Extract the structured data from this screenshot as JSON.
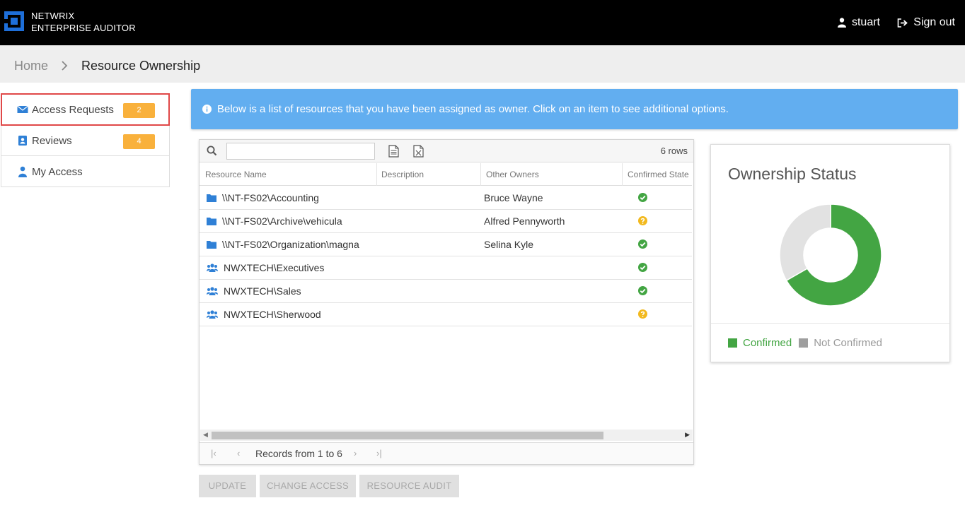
{
  "header": {
    "brand_line1": "NETWRIX",
    "brand_line2": "ENTERPRISE AUDITOR",
    "user_label": "stuart",
    "signout_label": "Sign out"
  },
  "breadcrumb": {
    "home": "Home",
    "separator": ">",
    "current": "Resource Ownership"
  },
  "sidebar": {
    "items": [
      {
        "label": "Access Requests",
        "badge": "2",
        "icon": "envelope-icon"
      },
      {
        "label": "Reviews",
        "badge": "4",
        "icon": "reviews-icon"
      },
      {
        "label": "My Access",
        "icon": "user-icon"
      }
    ]
  },
  "banner": {
    "text": "Below is a list of resources that you have been assigned as owner. Click on an item to see additional options."
  },
  "grid": {
    "search_value": "",
    "row_count": "6 rows",
    "columns": [
      "Resource Name",
      "Description",
      "Other Owners",
      "Confirmed State"
    ],
    "rows": [
      {
        "name": "\\\\NT-FS02\\Accounting",
        "description": "",
        "owner": "Bruce Wayne",
        "type": "folder",
        "state": "confirmed"
      },
      {
        "name": "\\\\NT-FS02\\Archive\\vehicula",
        "description": "",
        "owner": "Alfred Pennyworth",
        "type": "folder",
        "state": "unconfirmed"
      },
      {
        "name": "\\\\NT-FS02\\Organization\\magna",
        "description": "",
        "owner": "Selina Kyle",
        "type": "folder",
        "state": "confirmed"
      },
      {
        "name": "NWXTECH\\Executives",
        "description": "",
        "owner": "",
        "type": "group",
        "state": "confirmed"
      },
      {
        "name": "NWXTECH\\Sales",
        "description": "",
        "owner": "",
        "type": "group",
        "state": "confirmed"
      },
      {
        "name": "NWXTECH\\Sherwood",
        "description": "",
        "owner": "",
        "type": "group",
        "state": "unconfirmed"
      }
    ],
    "pager_text": "Records from 1 to 6"
  },
  "actions": {
    "update": "UPDATE",
    "change_access": "CHANGE ACCESS",
    "resource_audit": "RESOURCE AUDIT"
  },
  "ownership": {
    "title": "Ownership Status",
    "confirmed_label": "Confirmed",
    "not_confirmed_label": "Not Confirmed",
    "confirmed_count": 4,
    "not_confirmed_count": 2,
    "confirmed_color": "#43a543",
    "not_confirmed_color": "#e2e2e2"
  },
  "colors": {
    "badge": "#f9b13c",
    "banner": "#62aef0",
    "link_blue": "#2f80d6",
    "check_green": "#43a543",
    "question_yellow": "#f2b91e"
  }
}
